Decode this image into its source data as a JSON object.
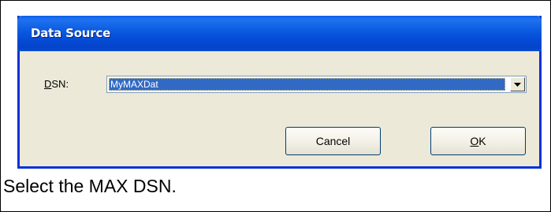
{
  "dialog": {
    "title": "Data Source",
    "dsn_label": "DSN:",
    "dsn_value": "MyMAXDat",
    "cancel_label": "Cancel",
    "ok_label": "OK"
  },
  "caption": "Select the MAX DSN.",
  "icons": {
    "dropdown": "chevron-down-icon"
  },
  "colors": {
    "titlebar": "#0a58df",
    "dialog_bg": "#ece9d8",
    "selection": "#316ac5",
    "button_border": "#003c74"
  }
}
